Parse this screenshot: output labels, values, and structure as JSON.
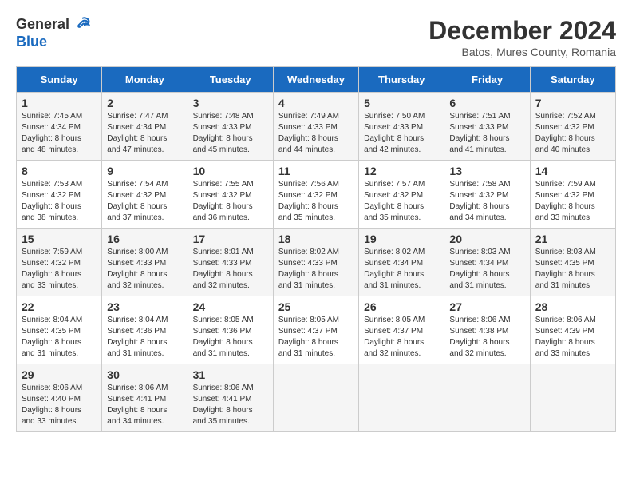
{
  "header": {
    "logo_line1": "General",
    "logo_line2": "Blue",
    "title": "December 2024",
    "subtitle": "Batos, Mures County, Romania"
  },
  "calendar": {
    "days_of_week": [
      "Sunday",
      "Monday",
      "Tuesday",
      "Wednesday",
      "Thursday",
      "Friday",
      "Saturday"
    ],
    "weeks": [
      [
        {
          "day": "",
          "info": ""
        },
        {
          "day": "2",
          "info": "Sunrise: 7:47 AM\nSunset: 4:34 PM\nDaylight: 8 hours\nand 47 minutes."
        },
        {
          "day": "3",
          "info": "Sunrise: 7:48 AM\nSunset: 4:33 PM\nDaylight: 8 hours\nand 45 minutes."
        },
        {
          "day": "4",
          "info": "Sunrise: 7:49 AM\nSunset: 4:33 PM\nDaylight: 8 hours\nand 44 minutes."
        },
        {
          "day": "5",
          "info": "Sunrise: 7:50 AM\nSunset: 4:33 PM\nDaylight: 8 hours\nand 42 minutes."
        },
        {
          "day": "6",
          "info": "Sunrise: 7:51 AM\nSunset: 4:33 PM\nDaylight: 8 hours\nand 41 minutes."
        },
        {
          "day": "7",
          "info": "Sunrise: 7:52 AM\nSunset: 4:32 PM\nDaylight: 8 hours\nand 40 minutes."
        }
      ],
      [
        {
          "day": "1",
          "info": "Sunrise: 7:45 AM\nSunset: 4:34 PM\nDaylight: 8 hours\nand 48 minutes."
        },
        {
          "day": "9",
          "info": "Sunrise: 7:54 AM\nSunset: 4:32 PM\nDaylight: 8 hours\nand 37 minutes."
        },
        {
          "day": "10",
          "info": "Sunrise: 7:55 AM\nSunset: 4:32 PM\nDaylight: 8 hours\nand 36 minutes."
        },
        {
          "day": "11",
          "info": "Sunrise: 7:56 AM\nSunset: 4:32 PM\nDaylight: 8 hours\nand 35 minutes."
        },
        {
          "day": "12",
          "info": "Sunrise: 7:57 AM\nSunset: 4:32 PM\nDaylight: 8 hours\nand 35 minutes."
        },
        {
          "day": "13",
          "info": "Sunrise: 7:58 AM\nSunset: 4:32 PM\nDaylight: 8 hours\nand 34 minutes."
        },
        {
          "day": "14",
          "info": "Sunrise: 7:59 AM\nSunset: 4:32 PM\nDaylight: 8 hours\nand 33 minutes."
        }
      ],
      [
        {
          "day": "8",
          "info": "Sunrise: 7:53 AM\nSunset: 4:32 PM\nDaylight: 8 hours\nand 38 minutes."
        },
        {
          "day": "16",
          "info": "Sunrise: 8:00 AM\nSunset: 4:33 PM\nDaylight: 8 hours\nand 32 minutes."
        },
        {
          "day": "17",
          "info": "Sunrise: 8:01 AM\nSunset: 4:33 PM\nDaylight: 8 hours\nand 32 minutes."
        },
        {
          "day": "18",
          "info": "Sunrise: 8:02 AM\nSunset: 4:33 PM\nDaylight: 8 hours\nand 31 minutes."
        },
        {
          "day": "19",
          "info": "Sunrise: 8:02 AM\nSunset: 4:34 PM\nDaylight: 8 hours\nand 31 minutes."
        },
        {
          "day": "20",
          "info": "Sunrise: 8:03 AM\nSunset: 4:34 PM\nDaylight: 8 hours\nand 31 minutes."
        },
        {
          "day": "21",
          "info": "Sunrise: 8:03 AM\nSunset: 4:35 PM\nDaylight: 8 hours\nand 31 minutes."
        }
      ],
      [
        {
          "day": "15",
          "info": "Sunrise: 7:59 AM\nSunset: 4:32 PM\nDaylight: 8 hours\nand 33 minutes."
        },
        {
          "day": "23",
          "info": "Sunrise: 8:04 AM\nSunset: 4:36 PM\nDaylight: 8 hours\nand 31 minutes."
        },
        {
          "day": "24",
          "info": "Sunrise: 8:05 AM\nSunset: 4:36 PM\nDaylight: 8 hours\nand 31 minutes."
        },
        {
          "day": "25",
          "info": "Sunrise: 8:05 AM\nSunset: 4:37 PM\nDaylight: 8 hours\nand 31 minutes."
        },
        {
          "day": "26",
          "info": "Sunrise: 8:05 AM\nSunset: 4:37 PM\nDaylight: 8 hours\nand 32 minutes."
        },
        {
          "day": "27",
          "info": "Sunrise: 8:06 AM\nSunset: 4:38 PM\nDaylight: 8 hours\nand 32 minutes."
        },
        {
          "day": "28",
          "info": "Sunrise: 8:06 AM\nSunset: 4:39 PM\nDaylight: 8 hours\nand 33 minutes."
        }
      ],
      [
        {
          "day": "22",
          "info": "Sunrise: 8:04 AM\nSunset: 4:35 PM\nDaylight: 8 hours\nand 31 minutes."
        },
        {
          "day": "30",
          "info": "Sunrise: 8:06 AM\nSunset: 4:41 PM\nDaylight: 8 hours\nand 34 minutes."
        },
        {
          "day": "31",
          "info": "Sunrise: 8:06 AM\nSunset: 4:41 PM\nDaylight: 8 hours\nand 35 minutes."
        },
        {
          "day": "",
          "info": ""
        },
        {
          "day": "",
          "info": ""
        },
        {
          "day": "",
          "info": ""
        },
        {
          "day": ""
        }
      ],
      [
        {
          "day": "29",
          "info": "Sunrise: 8:06 AM\nSunset: 4:40 PM\nDaylight: 8 hours\nand 33 minutes."
        },
        {
          "day": "",
          "info": ""
        },
        {
          "day": "",
          "info": ""
        },
        {
          "day": "",
          "info": ""
        },
        {
          "day": "",
          "info": ""
        },
        {
          "day": "",
          "info": ""
        },
        {
          "day": "",
          "info": ""
        }
      ]
    ]
  }
}
